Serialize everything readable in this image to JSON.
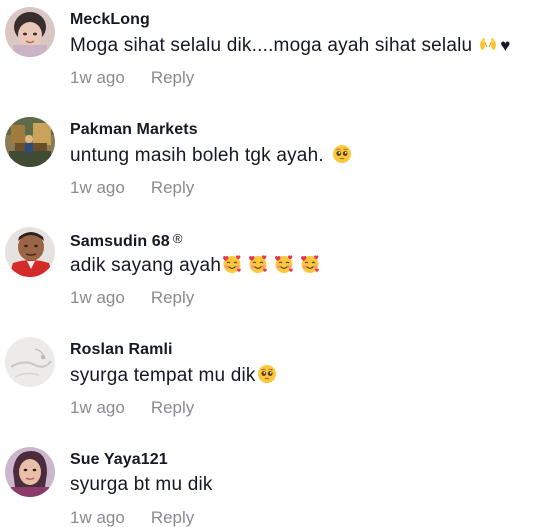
{
  "comments": [
    {
      "username": "MeckLong",
      "text": "Moga sihat selalu dik....moga ayah sihat selalu",
      "emojis": [
        "open-hands-emoji",
        "black-heart"
      ],
      "time": "1w ago",
      "reply_label": "Reply"
    },
    {
      "username": "Pakman Markets",
      "text": "untung masih boleh tgk ayah.",
      "emojis": [
        "pleading-face-emoji"
      ],
      "time": "1w ago",
      "reply_label": "Reply"
    },
    {
      "username": "Samsudin 68",
      "badge": "®",
      "text": "adik sayang ayah",
      "emojis": [
        "smiling-face-with-hearts-emoji",
        "smiling-face-with-hearts-emoji",
        "smiling-face-with-hearts-emoji",
        "smiling-face-with-hearts-emoji"
      ],
      "time": "1w ago",
      "reply_label": "Reply"
    },
    {
      "username": "Roslan Ramli",
      "text": "syurga tempat mu dik",
      "emojis": [
        "pleading-face-emoji"
      ],
      "time": "1w ago",
      "reply_label": "Reply"
    },
    {
      "username": "Sue Yaya121",
      "text": "syurga bt mu dik",
      "emojis": [],
      "time": "1w ago",
      "reply_label": "Reply"
    }
  ],
  "symbols": {
    "black_heart": "♥"
  },
  "colors": {
    "text": "#161823",
    "secondary_text": "#8a8b91",
    "background": "#ffffff"
  }
}
